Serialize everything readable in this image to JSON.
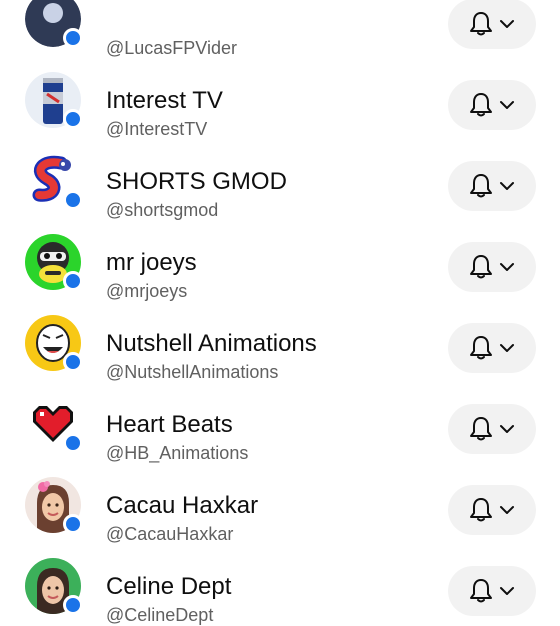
{
  "channels": [
    {
      "name": "",
      "handle": "@LucasFPVider",
      "notify_icon": "bell-icon",
      "dropdown_icon": "chevron-down-icon"
    },
    {
      "name": "Interest TV",
      "handle": "@InterestTV",
      "notify_icon": "bell-icon",
      "dropdown_icon": "chevron-down-icon"
    },
    {
      "name": "SHORTS GMOD",
      "handle": "@shortsgmod",
      "notify_icon": "bell-icon",
      "dropdown_icon": "chevron-down-icon"
    },
    {
      "name": "mr joeys",
      "handle": "@mrjoeys",
      "notify_icon": "bell-icon",
      "dropdown_icon": "chevron-down-icon"
    },
    {
      "name": "Nutshell Animations",
      "handle": "@NutshellAnimations",
      "notify_icon": "bell-icon",
      "dropdown_icon": "chevron-down-icon"
    },
    {
      "name": "Heart Beats",
      "handle": "@HB_Animations",
      "notify_icon": "bell-icon",
      "dropdown_icon": "chevron-down-icon"
    },
    {
      "name": "Cacau Haxkar",
      "handle": "@CacauHaxkar",
      "notify_icon": "bell-icon",
      "dropdown_icon": "chevron-down-icon"
    },
    {
      "name": "Celine Dept",
      "handle": "@CelineDept",
      "notify_icon": "bell-icon",
      "dropdown_icon": "chevron-down-icon"
    }
  ],
  "colors": {
    "new_content_dot": "#1a73e8",
    "button_bg": "#f2f2f2",
    "handle_text": "#606060"
  }
}
